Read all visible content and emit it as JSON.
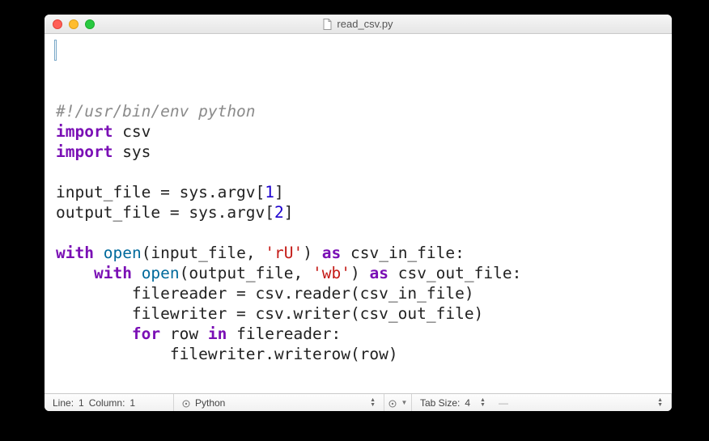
{
  "titlebar": {
    "filename": "read_csv.py"
  },
  "code": {
    "lines": [
      [
        {
          "cls": "tok-comment",
          "text": "#!/usr/bin/env python"
        }
      ],
      [
        {
          "cls": "tok-keyword",
          "text": "import"
        },
        {
          "cls": "tok-normal",
          "text": " csv"
        }
      ],
      [
        {
          "cls": "tok-keyword",
          "text": "import"
        },
        {
          "cls": "tok-normal",
          "text": " sys"
        }
      ],
      [],
      [
        {
          "cls": "tok-normal",
          "text": "input_file = sys.argv["
        },
        {
          "cls": "tok-number",
          "text": "1"
        },
        {
          "cls": "tok-normal",
          "text": "]"
        }
      ],
      [
        {
          "cls": "tok-normal",
          "text": "output_file = sys.argv["
        },
        {
          "cls": "tok-number",
          "text": "2"
        },
        {
          "cls": "tok-normal",
          "text": "]"
        }
      ],
      [],
      [
        {
          "cls": "tok-keyword",
          "text": "with"
        },
        {
          "cls": "tok-normal",
          "text": " "
        },
        {
          "cls": "tok-builtin",
          "text": "open"
        },
        {
          "cls": "tok-normal",
          "text": "(input_file, "
        },
        {
          "cls": "tok-string",
          "text": "'rU'"
        },
        {
          "cls": "tok-normal",
          "text": ") "
        },
        {
          "cls": "tok-keyword",
          "text": "as"
        },
        {
          "cls": "tok-normal",
          "text": " csv_in_file:"
        }
      ],
      [
        {
          "cls": "tok-normal",
          "text": "    "
        },
        {
          "cls": "tok-keyword",
          "text": "with"
        },
        {
          "cls": "tok-normal",
          "text": " "
        },
        {
          "cls": "tok-builtin",
          "text": "open"
        },
        {
          "cls": "tok-normal",
          "text": "(output_file, "
        },
        {
          "cls": "tok-string",
          "text": "'wb'"
        },
        {
          "cls": "tok-normal",
          "text": ") "
        },
        {
          "cls": "tok-keyword",
          "text": "as"
        },
        {
          "cls": "tok-normal",
          "text": " csv_out_file:"
        }
      ],
      [
        {
          "cls": "tok-normal",
          "text": "        filereader = csv.reader(csv_in_file)"
        }
      ],
      [
        {
          "cls": "tok-normal",
          "text": "        filewriter = csv.writer(csv_out_file)"
        }
      ],
      [
        {
          "cls": "tok-normal",
          "text": "        "
        },
        {
          "cls": "tok-keyword",
          "text": "for"
        },
        {
          "cls": "tok-normal",
          "text": " row "
        },
        {
          "cls": "tok-keyword",
          "text": "in"
        },
        {
          "cls": "tok-normal",
          "text": " filereader:"
        }
      ],
      [
        {
          "cls": "tok-normal",
          "text": "            filewriter.writerow(row)"
        }
      ]
    ]
  },
  "statusbar": {
    "line_label": "Line:",
    "line": "1",
    "column_label": "Column:",
    "column": "1",
    "syntax": "Python",
    "tab_label": "Tab Size:",
    "tab_size": "4"
  }
}
